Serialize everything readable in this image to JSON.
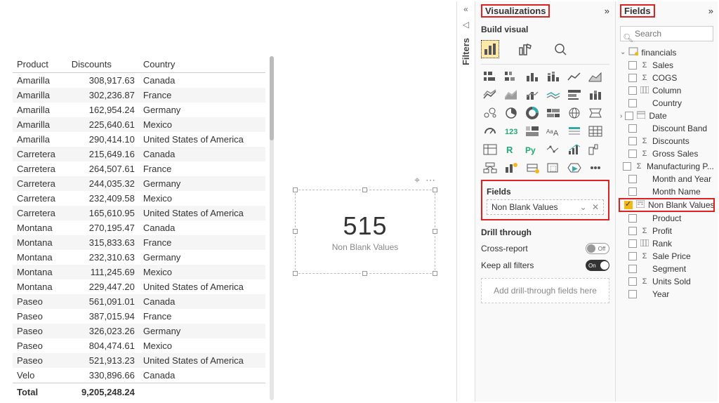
{
  "table": {
    "cols": [
      "Product",
      "Discounts",
      "Country"
    ],
    "rows": [
      [
        "Amarilla",
        "308,917.63",
        "Canada"
      ],
      [
        "Amarilla",
        "302,236.87",
        "France"
      ],
      [
        "Amarilla",
        "162,954.24",
        "Germany"
      ],
      [
        "Amarilla",
        "225,640.61",
        "Mexico"
      ],
      [
        "Amarilla",
        "290,414.10",
        "United States of America"
      ],
      [
        "Carretera",
        "215,649.16",
        "Canada"
      ],
      [
        "Carretera",
        "264,507.61",
        "France"
      ],
      [
        "Carretera",
        "244,035.32",
        "Germany"
      ],
      [
        "Carretera",
        "232,409.58",
        "Mexico"
      ],
      [
        "Carretera",
        "165,610.95",
        "United States of America"
      ],
      [
        "Montana",
        "270,195.47",
        "Canada"
      ],
      [
        "Montana",
        "315,833.63",
        "France"
      ],
      [
        "Montana",
        "232,310.63",
        "Germany"
      ],
      [
        "Montana",
        "111,245.69",
        "Mexico"
      ],
      [
        "Montana",
        "229,447.20",
        "United States of America"
      ],
      [
        "Paseo",
        "561,091.01",
        "Canada"
      ],
      [
        "Paseo",
        "387,015.94",
        "France"
      ],
      [
        "Paseo",
        "326,023.26",
        "Germany"
      ],
      [
        "Paseo",
        "804,474.61",
        "Mexico"
      ],
      [
        "Paseo",
        "521,913.23",
        "United States of America"
      ],
      [
        "Velo",
        "330,896.66",
        "Canada"
      ]
    ],
    "total_label": "Total",
    "total_value": "9,205,248.24"
  },
  "card": {
    "value": "515",
    "label": "Non Blank Values"
  },
  "filters_pane": {
    "title": "Filters"
  },
  "viz_pane": {
    "title": "Visualizations",
    "build": "Build visual",
    "fields_label": "Fields",
    "fieldwell": "Non Blank Values",
    "drill_label": "Drill through",
    "cross": "Cross-report",
    "cross_state": "Off",
    "keep": "Keep all filters",
    "keep_state": "On",
    "add_drill": "Add drill-through fields here"
  },
  "fields_pane": {
    "title": "Fields",
    "placeholder": "Search",
    "table_name": "financials",
    "fields": [
      {
        "name": "Sales",
        "icon": "Σ"
      },
      {
        "name": "COGS",
        "icon": "Σ"
      },
      {
        "name": "Column",
        "icon": "col"
      },
      {
        "name": "Country",
        "icon": ""
      },
      {
        "name": "Date",
        "icon": "date",
        "exp": true
      },
      {
        "name": "Discount Band",
        "icon": ""
      },
      {
        "name": "Discounts",
        "icon": "Σ"
      },
      {
        "name": "Gross Sales",
        "icon": "Σ"
      },
      {
        "name": "Manufacturing P...",
        "icon": "Σ"
      },
      {
        "name": "Month and Year",
        "icon": ""
      },
      {
        "name": "Month Name",
        "icon": ""
      },
      {
        "name": "Non Blank Values",
        "icon": "calc",
        "checked": true,
        "hl": true
      },
      {
        "name": "Product",
        "icon": ""
      },
      {
        "name": "Profit",
        "icon": "Σ"
      },
      {
        "name": "Rank",
        "icon": "col"
      },
      {
        "name": "Sale Price",
        "icon": "Σ"
      },
      {
        "name": "Segment",
        "icon": ""
      },
      {
        "name": "Units Sold",
        "icon": "Σ"
      },
      {
        "name": "Year",
        "icon": ""
      }
    ]
  }
}
